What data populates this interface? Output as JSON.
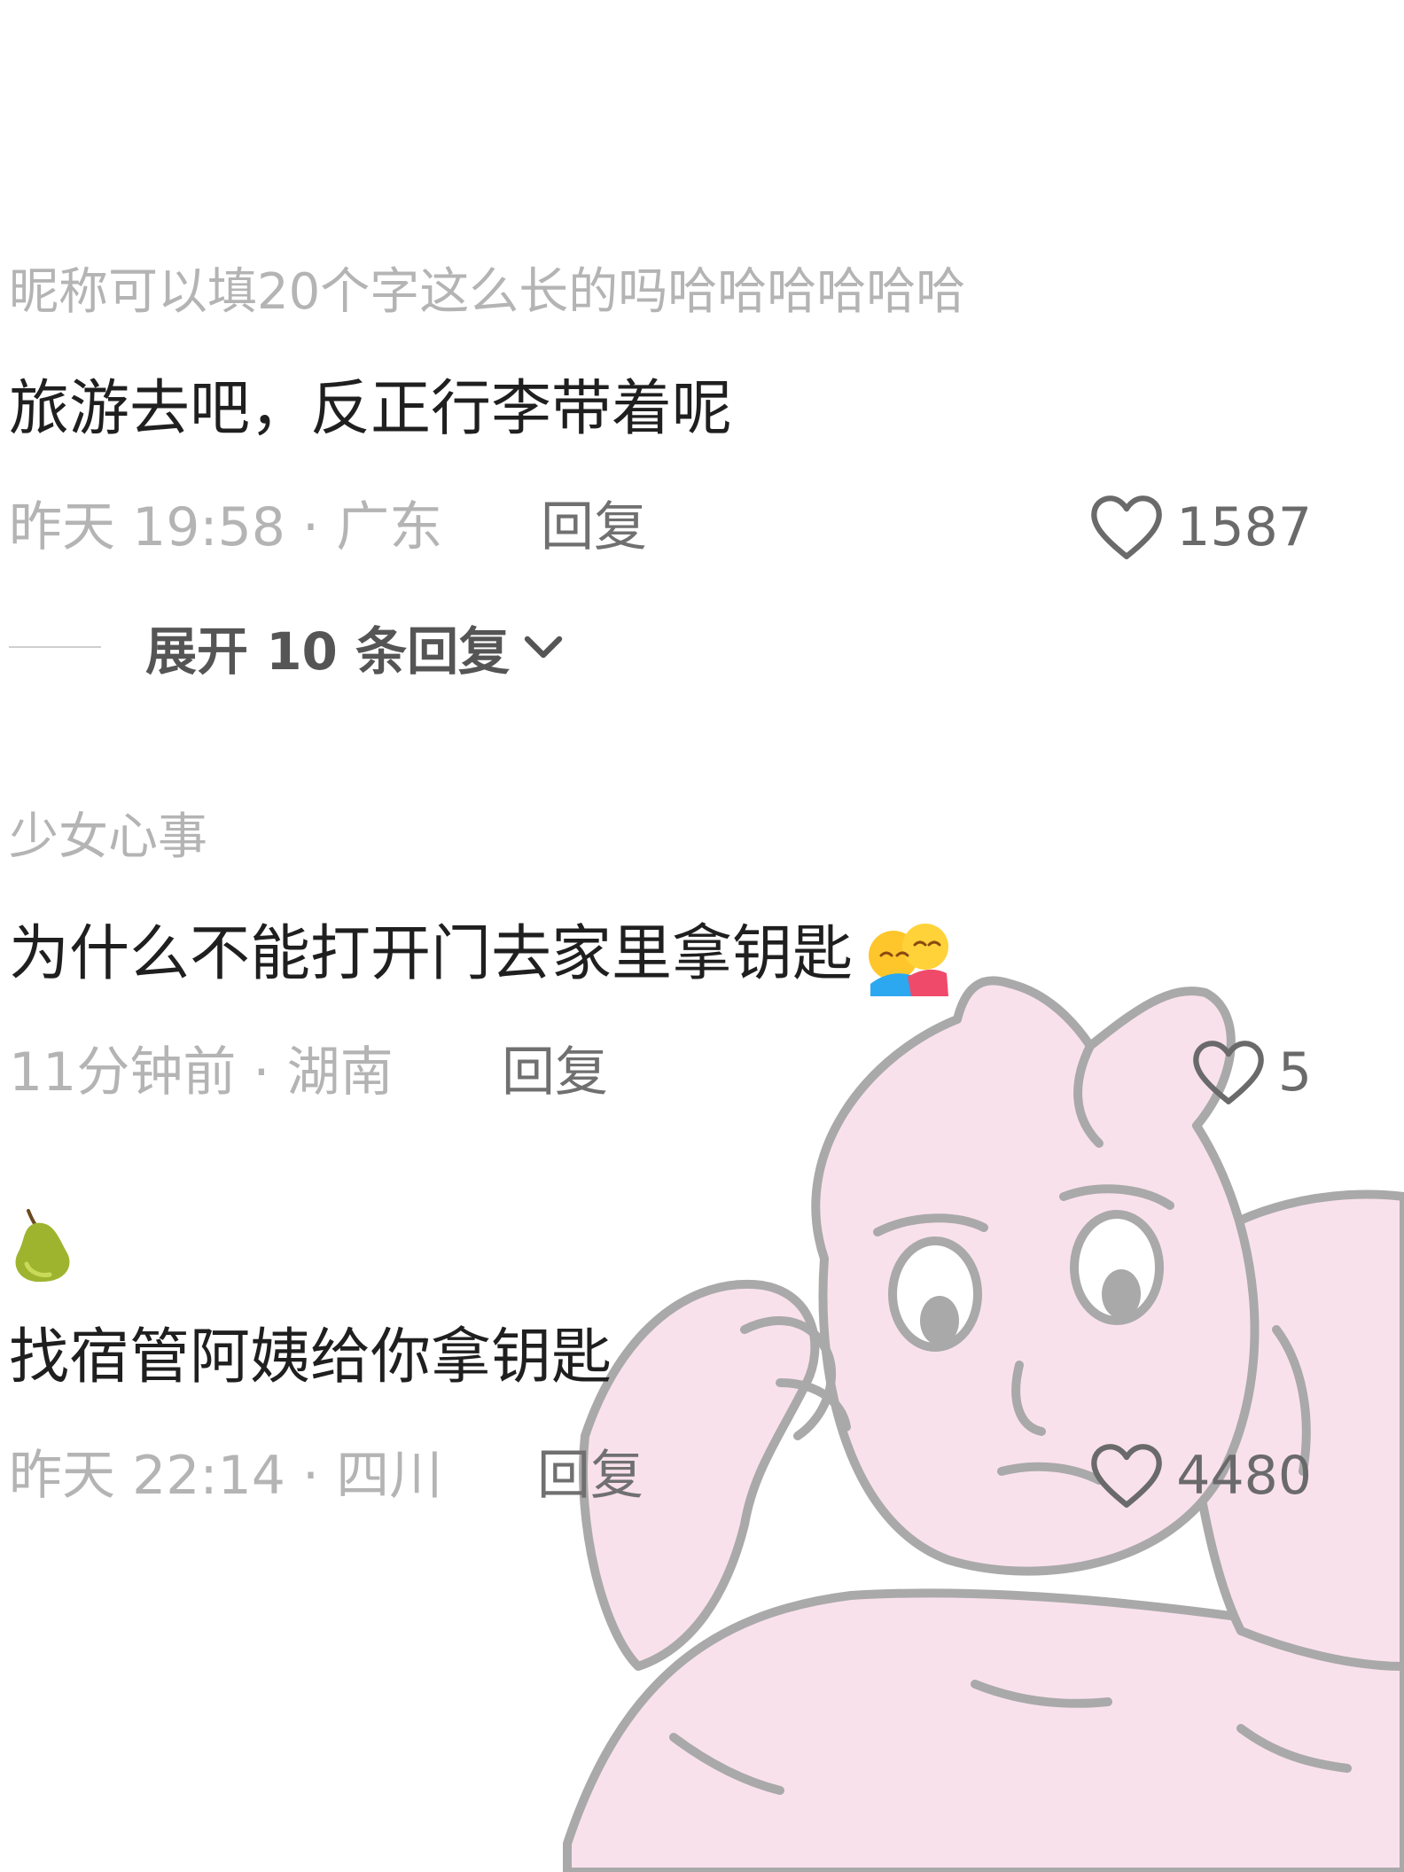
{
  "comments": [
    {
      "nickname": "昵称可以填20个字这么长的吗哈哈哈哈哈哈",
      "content": "旅游去吧，反正行李带着呢",
      "meta": "昨天 19:58 · 广东",
      "reply_label": "回复",
      "likes": "1587",
      "expand_label": "展开 10 条回复"
    },
    {
      "nickname": "少女心事",
      "content": "为什么不能打开门去家里拿钥匙",
      "meta": "11分钟前 · 湖南",
      "reply_label": "回复",
      "likes": "5",
      "emoji": "hug-emoji"
    },
    {
      "avatar_icon": "pear-icon",
      "content": "找宿管阿姨给你拿钥匙",
      "meta": "昨天 22:14 · 四川",
      "reply_label": "回复",
      "likes": "4480"
    }
  ],
  "sticker": "muscle-bunny-sticker",
  "colors": {
    "nickname": "#b4b4b4",
    "content": "#1f1f1f",
    "reply": "#707070",
    "sticker_fill": "#f9e1ec",
    "sticker_stroke": "#aaaaaa"
  }
}
